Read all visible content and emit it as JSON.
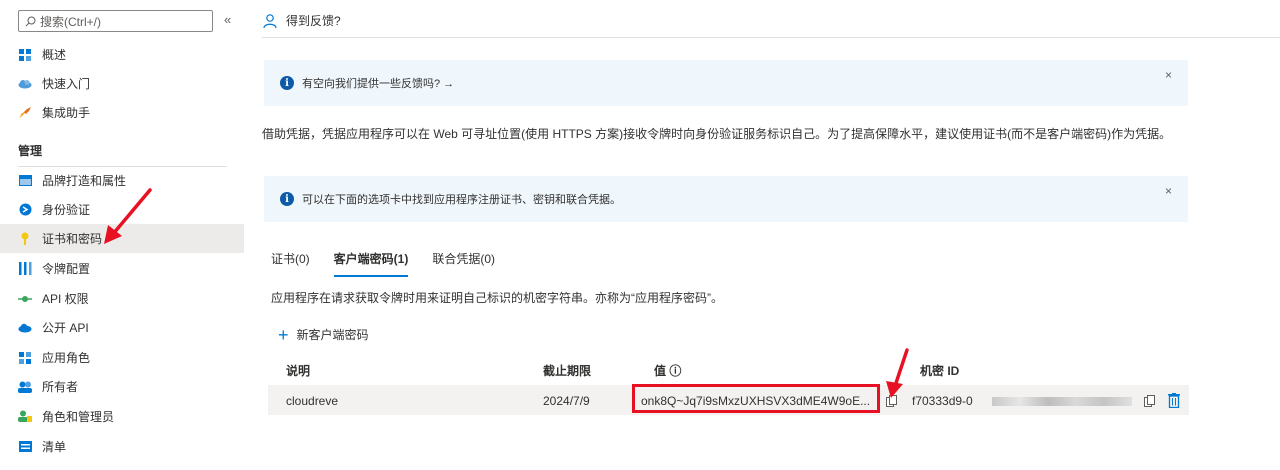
{
  "sidebar": {
    "search_placeholder": "搜索(Ctrl+/)",
    "collapse_glyph": "«",
    "top_items": [
      {
        "label": "概述",
        "icon": "grid-icon"
      },
      {
        "label": "快速入门",
        "icon": "cloud-icon"
      },
      {
        "label": "集成助手",
        "icon": "rocket-icon"
      }
    ],
    "section_title": "管理",
    "manage_items": [
      {
        "label": "品牌打造和属性",
        "icon": "brand-icon"
      },
      {
        "label": "身份验证",
        "icon": "auth-icon"
      },
      {
        "label": "证书和密码",
        "icon": "key-icon"
      },
      {
        "label": "令牌配置",
        "icon": "bars-icon"
      },
      {
        "label": "API 权限",
        "icon": "api-icon"
      },
      {
        "label": "公开 API",
        "icon": "cloud-api-icon"
      },
      {
        "label": "应用角色",
        "icon": "grid-icon"
      },
      {
        "label": "所有者",
        "icon": "users-icon"
      },
      {
        "label": "角色和管理员",
        "icon": "user-admin-icon"
      },
      {
        "label": "清单",
        "icon": "list-icon"
      }
    ]
  },
  "header": {
    "feedback_label": "得到反馈?"
  },
  "banner1": {
    "text": "有空向我们提供一些反馈吗? →",
    "close": "×"
  },
  "description": "借助凭据，凭据应用程序可以在 Web 可寻址位置(使用 HTTPS 方案)接收令牌时向身份验证服务标识自己。为了提高保障水平，建议使用证书(而不是客户端密码)作为凭据。",
  "banner2": {
    "text": "可以在下面的选项卡中找到应用程序注册证书、密钥和联合凭据。",
    "close": "×"
  },
  "tabs": [
    {
      "label": "证书(0)"
    },
    {
      "label": "客户端密码(1)"
    },
    {
      "label": "联合凭据(0)"
    }
  ],
  "tab_description": "应用程序在请求获取令牌时用来证明自己标识的机密字符串。亦称为“应用程序密码”。",
  "add_button": "新客户端密码",
  "table": {
    "headers": {
      "desc": "说明",
      "expires": "截止期限",
      "value": "值 ⓘ",
      "secret_id": "机密 ID"
    },
    "rows": [
      {
        "desc": "cloudreve",
        "expires": "2024/7/9",
        "value": "onk8Q~Jq7i9sMxzUXHSVX3dME4W9oE...",
        "secret_id": "f70333d9-0"
      }
    ]
  },
  "colors": {
    "accent": "#0078d4",
    "highlight": "#e81123",
    "banner_bg": "#eff6fc"
  }
}
